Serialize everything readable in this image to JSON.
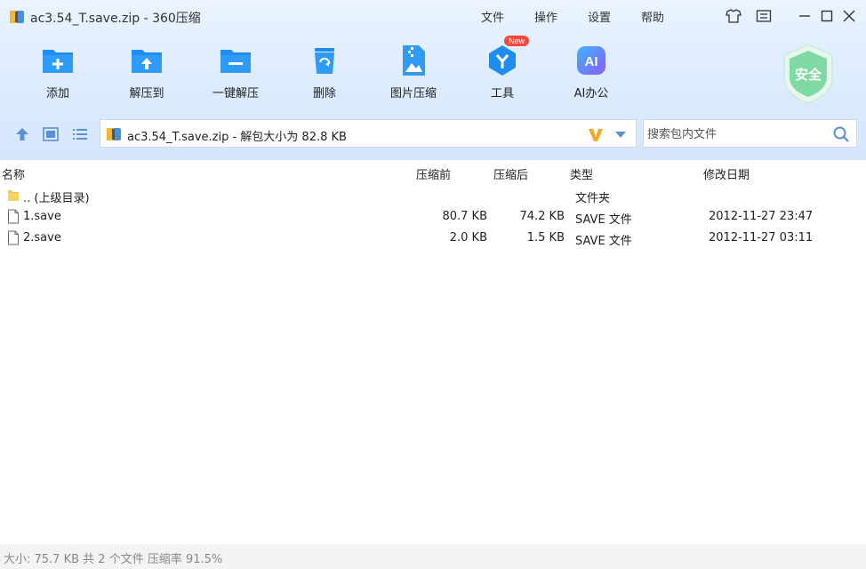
{
  "window": {
    "title": "ac3.54_T.save.zip - 360压缩"
  },
  "menu": [
    "文件",
    "操作",
    "设置",
    "帮助"
  ],
  "toolbar": [
    {
      "label": "添加",
      "icon": "add-icon"
    },
    {
      "label": "解压到",
      "icon": "extract-to-icon"
    },
    {
      "label": "一键解压",
      "icon": "one-click-extract-icon"
    },
    {
      "label": "删除",
      "icon": "delete-icon"
    },
    {
      "label": "图片压缩",
      "icon": "image-compress-icon"
    },
    {
      "label": "工具",
      "icon": "tools-icon",
      "badge": "New"
    },
    {
      "label": "AI办公",
      "icon": "ai-office-icon",
      "icon_text": "AI"
    }
  ],
  "security": {
    "label": "安全"
  },
  "path": {
    "text": "ac3.54_T.save.zip - 解包大小为 82.8 KB"
  },
  "search": {
    "placeholder": "搜索包内文件"
  },
  "columns": {
    "name": "名称",
    "before": "压缩前",
    "after": "压缩后",
    "type": "类型",
    "modified": "修改日期"
  },
  "files": [
    {
      "name": ".. (上级目录)",
      "before": "",
      "after": "",
      "type": "文件夹",
      "modified": "",
      "icon": "folder-icon"
    },
    {
      "name": "1.save",
      "before": "80.7 KB",
      "after": "74.2 KB",
      "type": "SAVE 文件",
      "modified": "2012-11-27 23:47",
      "icon": "file-icon"
    },
    {
      "name": "2.save",
      "before": "2.0 KB",
      "after": "1.5 KB",
      "type": "SAVE 文件",
      "modified": "2012-11-27 03:11",
      "icon": "file-icon"
    }
  ],
  "status": {
    "text": "大小: 75.7 KB 共 2 个文件 压缩率 91.5%"
  },
  "colors": {
    "accent": "#1e8cf0",
    "badge": "#f4483e",
    "shield": "#7fd9a5"
  }
}
